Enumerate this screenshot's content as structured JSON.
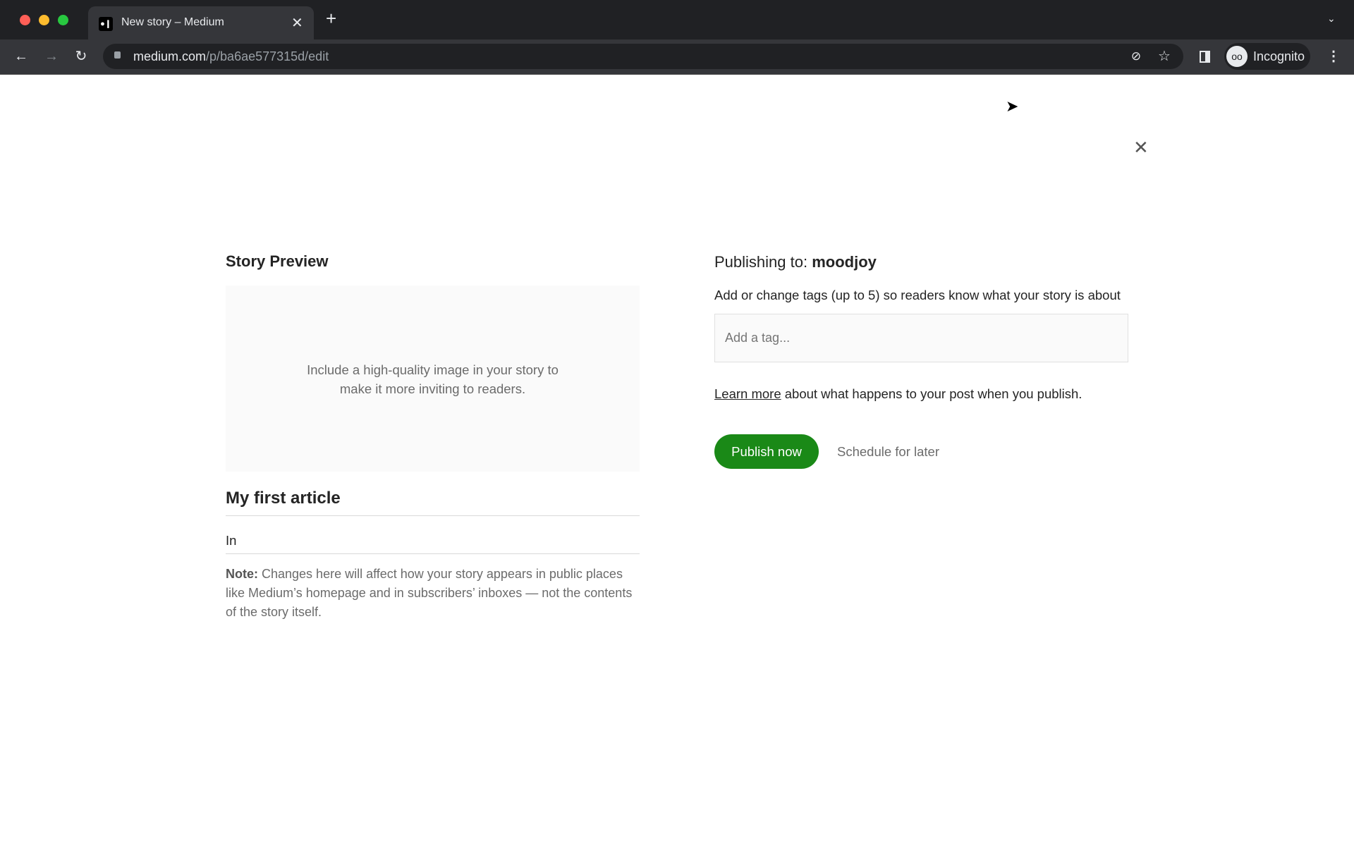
{
  "browser": {
    "tab_title": "New story – Medium",
    "url_domain": "medium.com",
    "url_path": "/p/ba6ae577315d/edit",
    "profile_label": "Incognito",
    "icons": [
      "back-icon",
      "forward-icon",
      "reload-icon",
      "lock-icon",
      "eye-off-icon",
      "star-icon",
      "side-panel-icon",
      "incognito-icon",
      "kebab-menu-icon",
      "new-tab-icon",
      "tab-close-icon",
      "tab-list-chevron-icon"
    ]
  },
  "preview": {
    "heading": "Story Preview",
    "image_hint_line1": "Include a high-quality image in your story to",
    "image_hint_line2": "make it more inviting to readers.",
    "title": "My first article",
    "subtitle": "In",
    "note_label": "Note:",
    "note_text": " Changes here will affect how your story appears in public places like Medium’s homepage and in subscribers’ inboxes — not the contents of the story itself."
  },
  "publish": {
    "publishing_to_label": "Publishing to: ",
    "publication": "moodjoy",
    "tags_hint": "Add or change tags (up to 5) so readers know what your story is about",
    "tag_placeholder": "Add a tag...",
    "learn_more": "Learn more",
    "learn_more_suffix": " about what happens to your post when you publish.",
    "publish_now": "Publish now",
    "schedule_later": "Schedule for later"
  },
  "colors": {
    "accent": "#1a8917",
    "chrome_bg": "#202124",
    "toolbar_bg": "#35363a"
  }
}
